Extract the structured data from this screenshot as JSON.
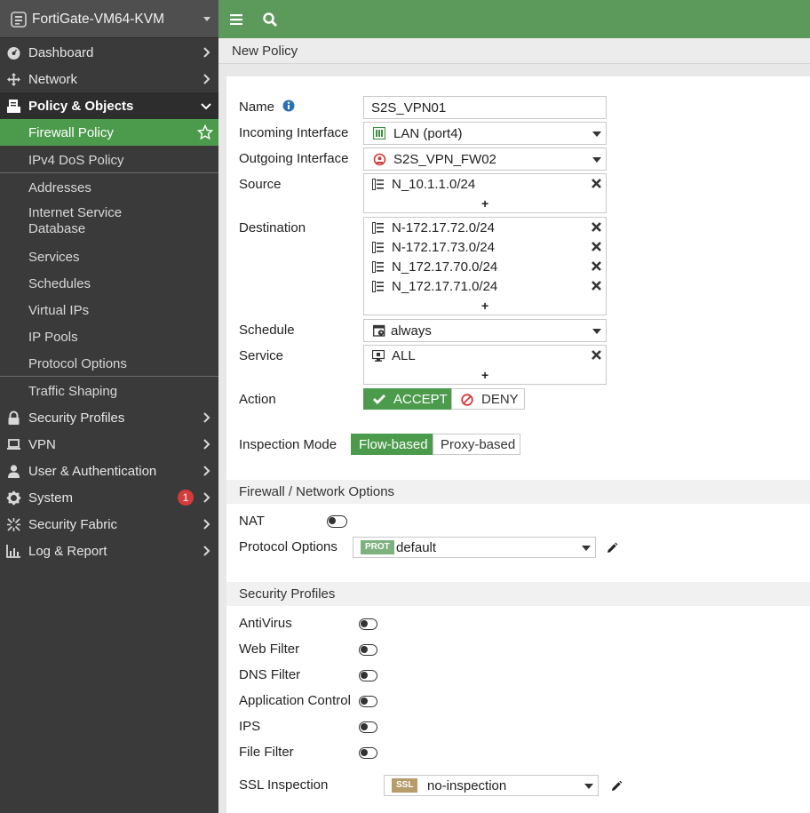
{
  "device": {
    "name": "FortiGate-VM64-KVM"
  },
  "sidebar": {
    "items": [
      {
        "label": "Dashboard",
        "icon": "dashboard-icon"
      },
      {
        "label": "Network",
        "icon": "network-icon"
      },
      {
        "label": "Policy & Objects",
        "icon": "policy-icon",
        "expanded": true
      },
      {
        "label": "Security Profiles",
        "icon": "lock-icon"
      },
      {
        "label": "VPN",
        "icon": "laptop-icon"
      },
      {
        "label": "User & Authentication",
        "icon": "user-icon"
      },
      {
        "label": "System",
        "icon": "gear-icon",
        "badge": "1"
      },
      {
        "label": "Security Fabric",
        "icon": "fabric-icon"
      },
      {
        "label": "Log & Report",
        "icon": "chart-icon"
      }
    ],
    "subitems": [
      {
        "label": "Firewall Policy",
        "active": true
      },
      {
        "label": "IPv4 DoS Policy"
      },
      {
        "label": "Addresses"
      },
      {
        "label": "Internet Service Database"
      },
      {
        "label": "Services"
      },
      {
        "label": "Schedules"
      },
      {
        "label": "Virtual IPs"
      },
      {
        "label": "IP Pools"
      },
      {
        "label": "Protocol Options"
      },
      {
        "label": "Traffic Shaping"
      }
    ]
  },
  "breadcrumb": {
    "title": "New Policy"
  },
  "form": {
    "name_label": "Name",
    "name_value": "S2S_VPN01",
    "incoming_label": "Incoming Interface",
    "incoming_value": "LAN (port4)",
    "outgoing_label": "Outgoing Interface",
    "outgoing_value": "S2S_VPN_FW02",
    "source_label": "Source",
    "source_items": [
      "N_10.1.1.0/24"
    ],
    "destination_label": "Destination",
    "destination_items": [
      "N-172.17.72.0/24",
      "N-172.17.73.0/24",
      "N_172.17.70.0/24",
      "N_172.17.71.0/24"
    ],
    "schedule_label": "Schedule",
    "schedule_value": "always",
    "service_label": "Service",
    "service_items": [
      "ALL"
    ],
    "plus": "+",
    "action_label": "Action",
    "action_accept": "ACCEPT",
    "action_deny": "DENY",
    "inspection_label": "Inspection Mode",
    "inspection_flow": "Flow-based",
    "inspection_proxy": "Proxy-based"
  },
  "firewall_section": {
    "title": "Firewall / Network Options",
    "nat_label": "NAT",
    "protocol_label": "Protocol Options",
    "protocol_tag": "PROT",
    "protocol_value": "default"
  },
  "security_section": {
    "title": "Security Profiles",
    "toggles": [
      "AntiVirus",
      "Web Filter",
      "DNS Filter",
      "Application Control",
      "IPS",
      "File Filter"
    ],
    "ssl_label": "SSL Inspection",
    "ssl_tag": "SSL",
    "ssl_value": "no-inspection"
  },
  "colors": {
    "accent": "#5b9a5b",
    "active": "#4c9b4c",
    "sidebar": "#3a3a3a",
    "badge": "#d63b3b",
    "deny": "#d63b3b"
  }
}
